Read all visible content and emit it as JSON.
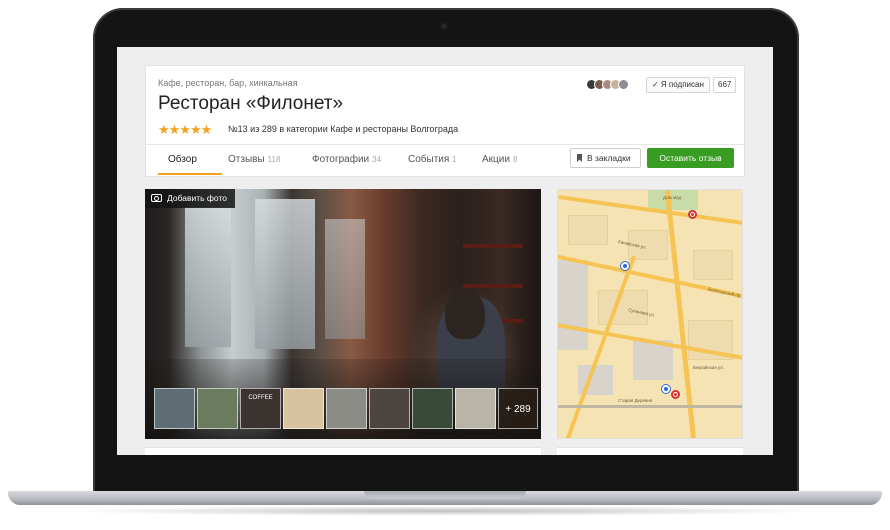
{
  "header": {
    "category": "Кафе, ресторан, бар, хинкальная",
    "title": "Ресторан «Филонет»",
    "stars": "★★★★★",
    "rank": "№13 из 289 в категории Кафе и рестораны Волгограда",
    "subscribe_label": "✓ Я подписан",
    "subscribers": "667"
  },
  "tabs": [
    {
      "label": "Обзор",
      "count": ""
    },
    {
      "label": "Отзывы",
      "count": "118"
    },
    {
      "label": "Фотографии",
      "count": "34"
    },
    {
      "label": "События",
      "count": "1"
    },
    {
      "label": "Акции",
      "count": "8"
    }
  ],
  "actions": {
    "bookmark_label": "В закладки",
    "review_label": "Оставить отзыв"
  },
  "photo": {
    "add_photo_label": "Добавить фото",
    "more_label": "+ 289",
    "thumb_colors": [
      "#5f6e74",
      "#6a7b5e",
      "#3b3330",
      "#d8c2a0",
      "#8a8c85",
      "#4d4640",
      "#3a4a3a",
      "#b9b4a8",
      "#a89b8a"
    ],
    "thumb_text": [
      "",
      "",
      "COFFEE",
      "",
      "",
      "",
      "",
      "",
      ""
    ]
  },
  "colors": {
    "accent": "#f2a21b",
    "primary_button": "#3a9d23",
    "metro": "#d6332b",
    "pin": "#2b6bd6"
  }
}
